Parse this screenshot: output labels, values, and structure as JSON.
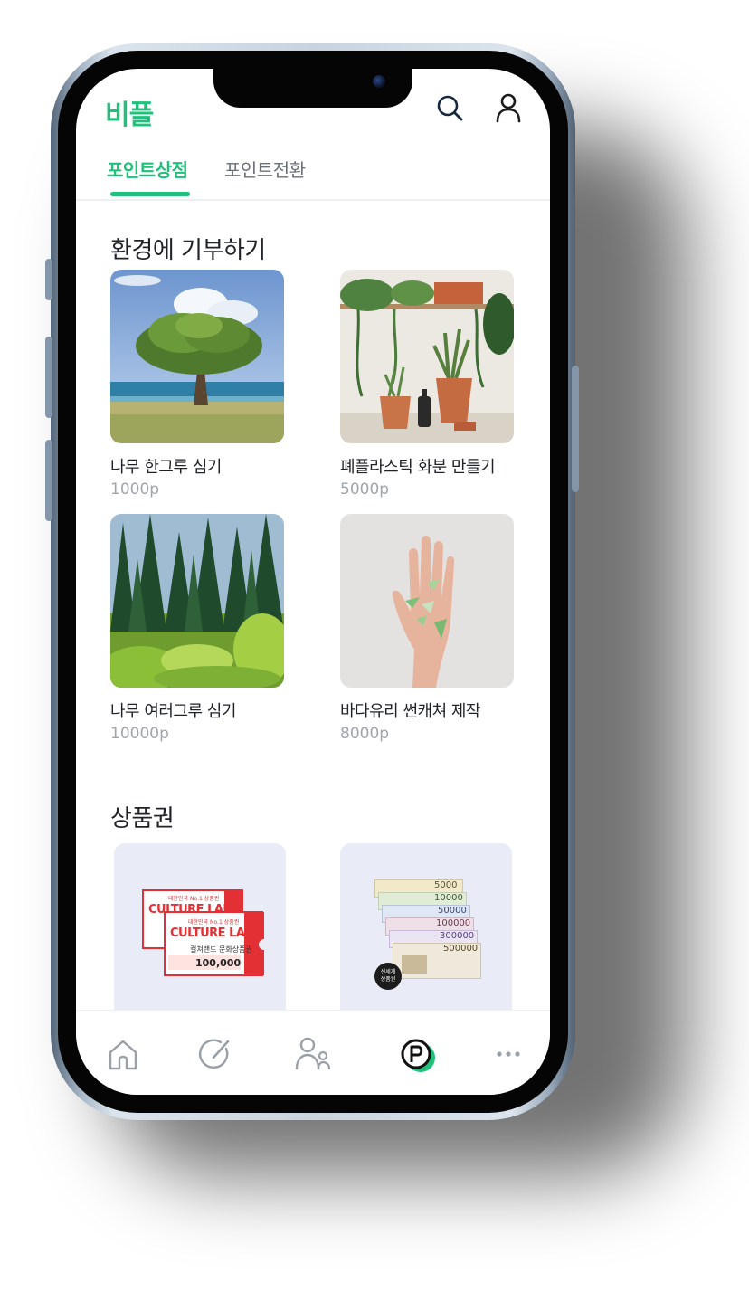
{
  "app": {
    "logo_text": "비플",
    "accent_color": "#20c17a"
  },
  "header": {
    "icons": [
      "search-icon",
      "user-icon"
    ]
  },
  "tabs": [
    {
      "label": "포인트상점",
      "active": true
    },
    {
      "label": "포인트전환",
      "active": false
    }
  ],
  "donation": {
    "title": "환경에 기부하기",
    "items": [
      {
        "name": "나무 한그루 심기",
        "price": "1000p"
      },
      {
        "name": "폐플라스틱 화분 만들기",
        "price": "5000p"
      },
      {
        "name": "나무 여러그루 심기",
        "price": "10000p"
      },
      {
        "name": "바다유리 썬캐쳐 제작",
        "price": "8000p"
      }
    ]
  },
  "vouchers": {
    "title": "상품권",
    "culture_land": {
      "brand": "CULTURE LAND",
      "tagline": "대한민국 No.1 상품권",
      "label": "컬쳐랜드 문화상품권",
      "amount": "100,000"
    },
    "shinsegae": {
      "denominations": [
        "5000",
        "10000",
        "50000",
        "100000",
        "300000",
        "500000"
      ],
      "badge_line1": "신세계",
      "badge_line2": "상품권"
    }
  },
  "bottom_nav": [
    "home-icon",
    "edit-icon",
    "community-icon",
    "point-icon",
    "more-icon"
  ]
}
